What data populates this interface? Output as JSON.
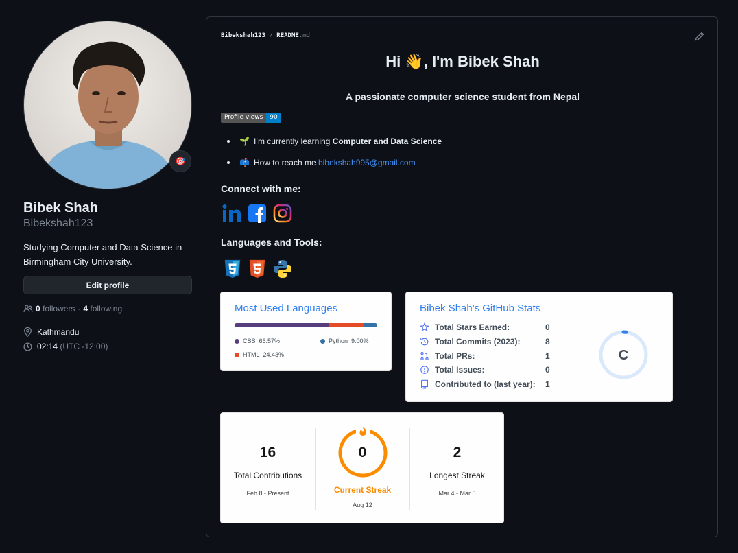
{
  "profile": {
    "name": "Bibek Shah",
    "username": "Bibekshah123",
    "bio": "Studying Computer and Data Science in Birmingham City University.",
    "edit_label": "Edit profile",
    "followers_count": "0",
    "followers_label": "followers",
    "dot": "·",
    "following_count": "4",
    "following_label": "following",
    "location": "Kathmandu",
    "local_time": "02:14",
    "timezone": "(UTC -12:00)",
    "status_emoji": "🎯"
  },
  "readme": {
    "path_user": "Bibekshah123",
    "path_sep": "/",
    "path_file": "README",
    "path_ext": ".md",
    "title": "Hi 👋, I'm Bibek Shah",
    "subtitle": "A passionate computer science student from Nepal",
    "views_label": "Profile views",
    "views_count": "90",
    "bullets": [
      {
        "emoji": "🌱",
        "text": "I’m currently learning ",
        "bold": "Computer and Data Science"
      },
      {
        "emoji": "📫",
        "text": "How to reach me ",
        "link": "bibekshah995@gmail.com"
      }
    ],
    "connect_heading": "Connect with me:",
    "social_icons": [
      "linkedin-icon",
      "facebook-icon",
      "instagram-icon"
    ],
    "tools_heading": "Languages and Tools:",
    "tool_icons": [
      "css3-icon",
      "html5-icon",
      "python-icon"
    ]
  },
  "languages_card": {
    "title": "Most Used Languages",
    "items": [
      {
        "name": "CSS",
        "percent": "66.57%",
        "value": 66.57,
        "color": "#563d7c"
      },
      {
        "name": "HTML",
        "percent": "24.43%",
        "value": 24.43,
        "color": "#e34c26"
      },
      {
        "name": "Python",
        "percent": "9.00%",
        "value": 9.0,
        "color": "#3572A5"
      }
    ]
  },
  "stats_card": {
    "title": "Bibek Shah's GitHub Stats",
    "rows": [
      {
        "label": "Total Stars Earned:",
        "value": "0",
        "icon": "star-icon"
      },
      {
        "label": "Total Commits (2023):",
        "value": "8",
        "icon": "history-icon"
      },
      {
        "label": "Total PRs:",
        "value": "1",
        "icon": "pull-request-icon"
      },
      {
        "label": "Total Issues:",
        "value": "0",
        "icon": "issue-icon"
      },
      {
        "label": "Contributed to (last year):",
        "value": "1",
        "icon": "repo-icon"
      }
    ],
    "rank": "C",
    "rank_progress": 0.02
  },
  "streak_card": {
    "total": "16",
    "total_label": "Total Contributions",
    "total_range": "Feb 8 - Present",
    "current": "0",
    "current_label": "Current Streak",
    "current_range": "Aug 12",
    "longest": "2",
    "longest_label": "Longest Streak",
    "longest_range": "Mar 4 - Mar 5"
  },
  "colors": {
    "accent": "#2f80ed",
    "streak_orange": "#fb8c00",
    "link": "#4493f8"
  }
}
